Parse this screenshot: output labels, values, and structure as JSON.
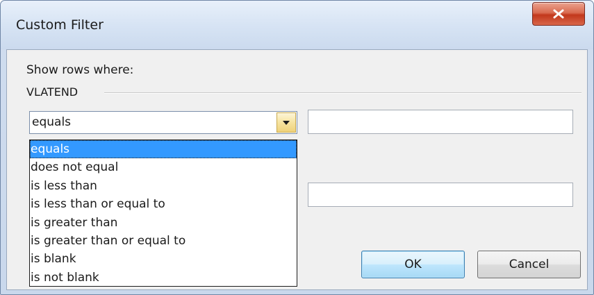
{
  "window": {
    "title": "Custom Filter"
  },
  "titlebar": {
    "close_icon": "close-x-icon",
    "close_color": "#c2381c"
  },
  "form": {
    "prompt": "Show rows where:",
    "field_name": "VLATEND",
    "operator": {
      "selected": "equals",
      "arrow_icon": "chevron-down-icon",
      "options": [
        "equals",
        "does not equal",
        "is less than",
        "is less than or equal to",
        "is greater than",
        "is greater than or equal to",
        "is blank",
        "is not blank"
      ],
      "highlighted_index": 0,
      "highlight_color": "#3399ff"
    },
    "value1": "",
    "value2": ""
  },
  "buttons": {
    "ok": "OK",
    "cancel": "Cancel"
  }
}
